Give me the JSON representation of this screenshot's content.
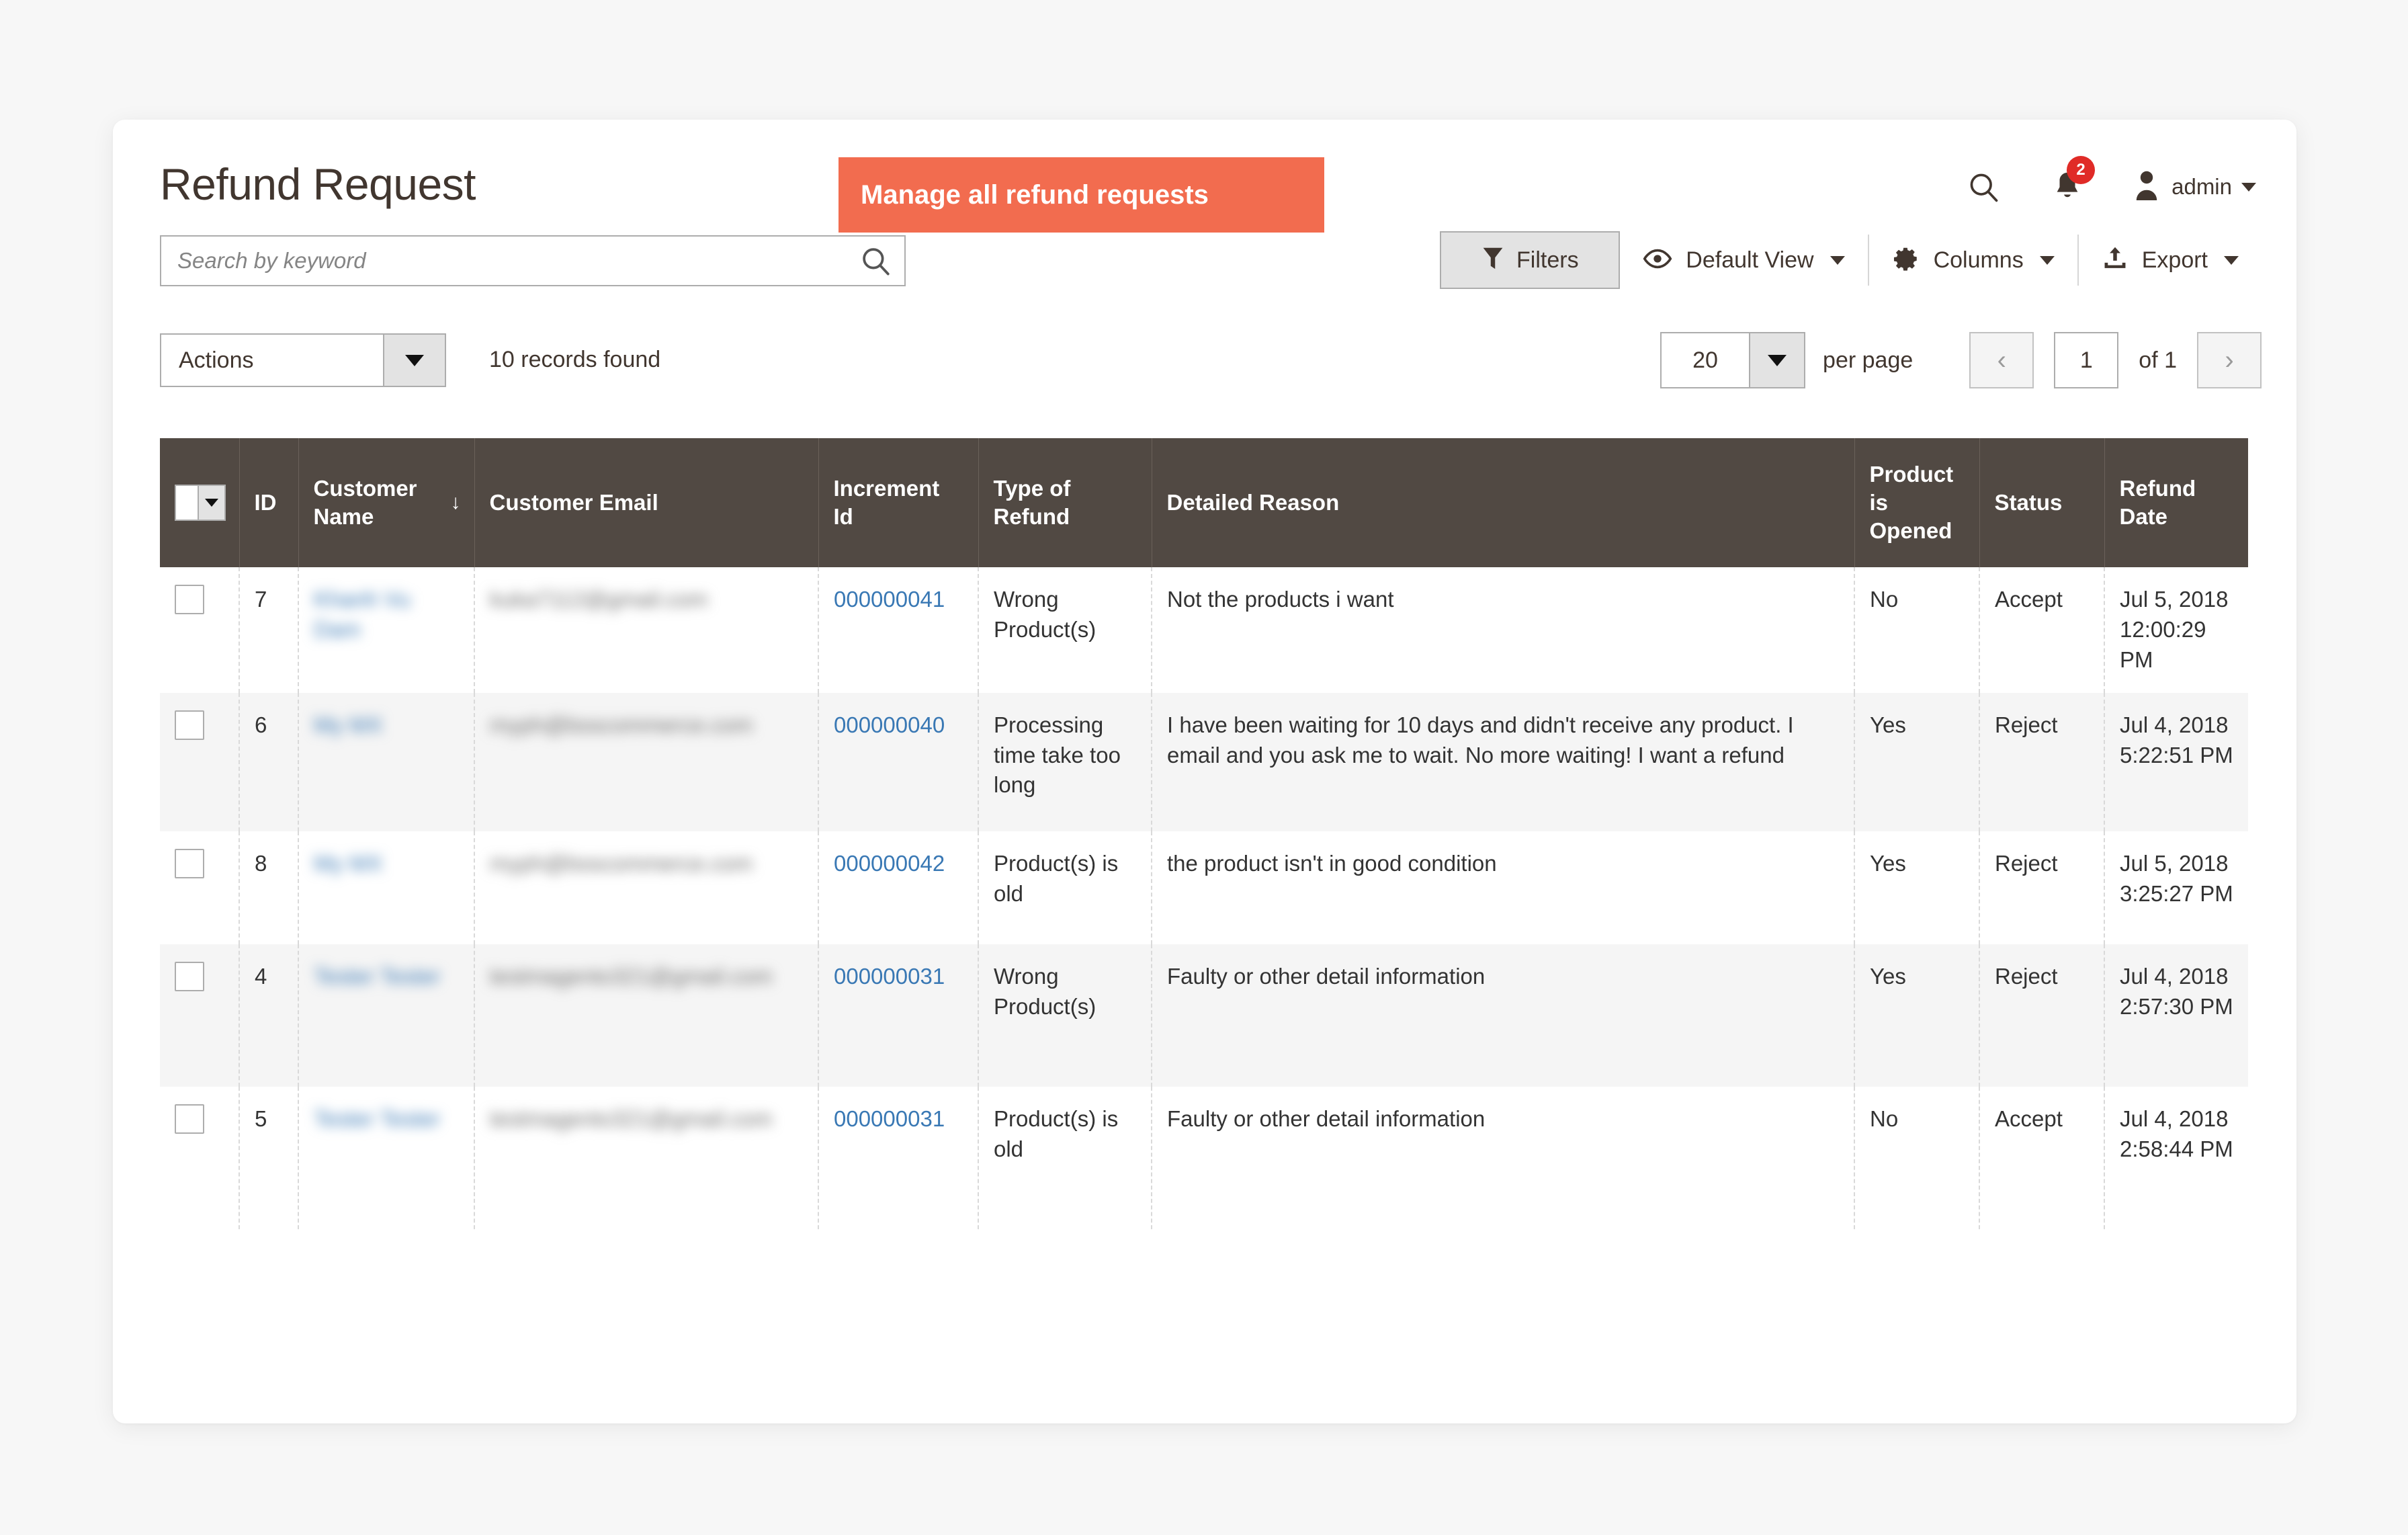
{
  "header": {
    "title": "Refund Request",
    "banner_text": "Manage all refund requests",
    "notification_count": "2",
    "user_name": "admin",
    "accent_color": "#f26c4f",
    "table_header_color": "#514943",
    "link_color": "#3978b4"
  },
  "search": {
    "placeholder": "Search by keyword",
    "value": ""
  },
  "toolbar": {
    "filters_label": "Filters",
    "view_label": "Default View",
    "columns_label": "Columns",
    "export_label": "Export"
  },
  "actions": {
    "label": "Actions",
    "records_found": "10 records found"
  },
  "pager": {
    "per_page_value": "20",
    "per_page_label": "per page",
    "current_page": "1",
    "of_label": "of 1",
    "prev_glyph": "‹",
    "next_glyph": "›"
  },
  "table": {
    "columns": [
      {
        "key": "check",
        "label": ""
      },
      {
        "key": "id",
        "label": "ID"
      },
      {
        "key": "name",
        "label": "Customer Name",
        "sorted": true,
        "sort_dir": "↓"
      },
      {
        "key": "email",
        "label": "Customer Email"
      },
      {
        "key": "inc",
        "label": "Increment Id"
      },
      {
        "key": "type",
        "label": "Type of Refund"
      },
      {
        "key": "reason",
        "label": "Detailed Reason"
      },
      {
        "key": "open",
        "label": "Product is Opened"
      },
      {
        "key": "status",
        "label": "Status"
      },
      {
        "key": "date",
        "label": "Refund Date"
      }
    ],
    "rows": [
      {
        "id": "7",
        "customer_name": "Khanh Vu Dam",
        "customer_email": "kuka7112@gmail.com",
        "increment_id": "000000041",
        "type_of_refund": "Wrong Product(s)",
        "detailed_reason": "Not the products i want",
        "product_is_opened": "No",
        "status": "Accept",
        "refund_date": "Jul 5, 2018 12:00:29 PM"
      },
      {
        "id": "6",
        "customer_name": "My MX",
        "customer_email": "myph@bsscommerce.com",
        "increment_id": "000000040",
        "type_of_refund": "Processing time take too long",
        "detailed_reason": "I have been waiting for 10 days and didn't receive any product. I email and you ask me to wait. No more waiting! I want a refund",
        "product_is_opened": "Yes",
        "status": "Reject",
        "refund_date": "Jul 4, 2018 5:22:51 PM"
      },
      {
        "id": "8",
        "customer_name": "My MX",
        "customer_email": "myph@bsscommerce.com",
        "increment_id": "000000042",
        "type_of_refund": "Product(s) is old",
        "detailed_reason": "the product isn't in good condition",
        "product_is_opened": "Yes",
        "status": "Reject",
        "refund_date": "Jul 5, 2018 3:25:27 PM"
      },
      {
        "id": "4",
        "customer_name": "Tester Tester",
        "customer_email": "testmagento321@gmail.com",
        "increment_id": "000000031",
        "type_of_refund": "Wrong Product(s)",
        "detailed_reason": "Faulty or other detail information",
        "product_is_opened": "Yes",
        "status": "Reject",
        "refund_date": "Jul 4, 2018 2:57:30 PM"
      },
      {
        "id": "5",
        "customer_name": "Tester Tester",
        "customer_email": "testmagento321@gmail.com",
        "increment_id": "000000031",
        "type_of_refund": "Product(s) is old",
        "detailed_reason": "Faulty or other detail information",
        "product_is_opened": "No",
        "status": "Accept",
        "refund_date": "Jul 4, 2018 2:58:44 PM"
      }
    ]
  }
}
